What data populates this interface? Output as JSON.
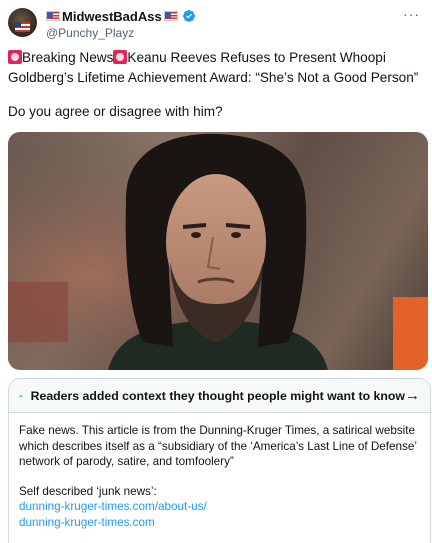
{
  "author": {
    "display_name": "MidwestBadAss",
    "handle": "@Punchy_Playz",
    "verified": true
  },
  "more_label": "···",
  "tweet": {
    "headline_prefix": "Breaking News",
    "headline_rest": "Keanu Reeves Refuses to Present Whoopi",
    "headline_line2": "Goldberg’s Lifetime Achievement Award: “She’s Not a Good Person”",
    "question": "Do you agree or disagree with him?"
  },
  "community_note": {
    "title": "Readers added context they thought people might want to know",
    "body_lines": [
      "Fake news. This article is from the Dunning-Kruger Times, a satirical website",
      "which describes itself as a “subsidiary of the ‘America’s Last Line of Defense’",
      "network of parody, satire, and tomfoolery”"
    ],
    "self_described": "Self described ‘junk news’:",
    "links": [
      "dunning-kruger-times.com/about-us/",
      "dunning-kruger-times.com"
    ]
  },
  "colors": {
    "accent": "#1d9bf0",
    "text": "#0f1419",
    "secondary": "#536471",
    "border": "#cfd9de"
  }
}
